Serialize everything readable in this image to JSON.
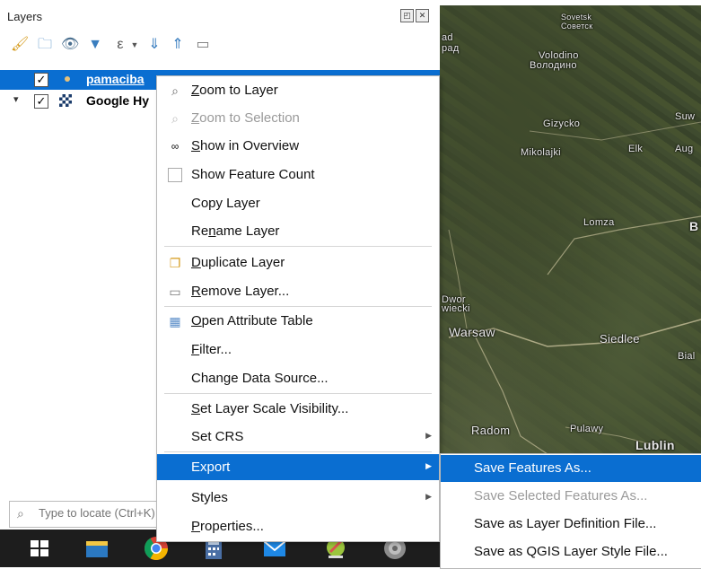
{
  "panel": {
    "title": "Layers",
    "float_btn": "◰",
    "close_btn": "✕",
    "toolbar": [
      {
        "name": "style-manager-icon",
        "glyph": "🖌",
        "color": "#d59a1a"
      },
      {
        "name": "add-group-icon",
        "glyph": "🗀",
        "color": "#3a7ebf"
      },
      {
        "name": "manage-visibility-icon",
        "glyph": "👁",
        "color": "#4a6f8f"
      },
      {
        "name": "filter-legend-icon",
        "glyph": "▼",
        "color": "#3a7ebf"
      },
      {
        "name": "filter-expression-icon",
        "glyph": "ε",
        "color": "#555555"
      },
      {
        "name": "expand-all-icon",
        "glyph": "⇓",
        "color": "#3a7ebf"
      },
      {
        "name": "collapse-all-icon",
        "glyph": "⇑",
        "color": "#3a7ebf"
      },
      {
        "name": "remove-layer-icon",
        "glyph": "▭",
        "color": "#777777"
      }
    ],
    "layers": [
      {
        "name": "pamaciba",
        "checked": "✓",
        "selected": true
      },
      {
        "name": "Google Hy",
        "checked": "✓",
        "expander": "▾"
      }
    ],
    "search_placeholder": "Type to locate (Ctrl+K)",
    "search_icon": "⌕"
  },
  "menu": {
    "items": [
      {
        "label": "Zoom to Layer",
        "icon": "zoom-icon",
        "glyph": "🔍"
      },
      {
        "label": "Zoom to Selection",
        "icon": "zoom-selection-icon",
        "glyph": "🔍",
        "disabled": true
      },
      {
        "label": "Show in Overview",
        "icon": "overview-icon",
        "glyph": "👓"
      },
      {
        "label": "Show Feature Count",
        "icon": "checkbox-icon",
        "glyph": ""
      },
      {
        "label": "Copy Layer"
      },
      {
        "label": "Rename Layer"
      },
      {
        "label": "Duplicate Layer",
        "icon": "duplicate-icon",
        "glyph": "❐"
      },
      {
        "label": "Remove Layer...",
        "icon": "remove-icon",
        "glyph": "▭"
      },
      {
        "label": "Open Attribute Table",
        "icon": "table-icon",
        "glyph": "▦"
      },
      {
        "label": "Filter..."
      },
      {
        "label": "Change Data Source..."
      },
      {
        "label": "Set Layer Scale Visibility..."
      },
      {
        "label": "Set CRS",
        "arrow": "▶"
      },
      {
        "label": "Export",
        "arrow": "▶",
        "highlighted": true
      },
      {
        "label": "Styles",
        "arrow": "▶"
      },
      {
        "label": "Properties..."
      }
    ]
  },
  "submenu": {
    "items": [
      {
        "label": "Save Features As...",
        "highlighted": true
      },
      {
        "label": "Save Selected Features As...",
        "disabled": true
      },
      {
        "label": "Save as Layer Definition File..."
      },
      {
        "label": "Save as QGIS Layer Style File..."
      }
    ]
  },
  "map_labels": [
    {
      "text": "Sovetsk"
    },
    {
      "text": "Советск"
    },
    {
      "text": "ad"
    },
    {
      "text": "рад"
    },
    {
      "text": "Volodino"
    },
    {
      "text": "Володино"
    },
    {
      "text": "Gizycko"
    },
    {
      "text": "Suw"
    },
    {
      "text": "Mikolajki"
    },
    {
      "text": "Elk"
    },
    {
      "text": "Aug"
    },
    {
      "text": "Lomza"
    },
    {
      "text": "B"
    },
    {
      "text": "Dwor"
    },
    {
      "text": "wiecki"
    },
    {
      "text": "Warsaw"
    },
    {
      "text": "Siedlce"
    },
    {
      "text": "Bial"
    },
    {
      "text": "Radom"
    },
    {
      "text": "Pulawy"
    },
    {
      "text": "Lublin"
    }
  ],
  "taskbar": [
    {
      "name": "windows-start-icon",
      "color": "#ffffff"
    },
    {
      "name": "file-explorer-icon",
      "color": "#f2c744"
    },
    {
      "name": "chrome-icon",
      "color": "#db4437"
    },
    {
      "name": "calculator-icon",
      "color": "#4a6fa5"
    },
    {
      "name": "mail-icon",
      "color": "#1e88e5"
    },
    {
      "name": "qgis-icon",
      "color": "#d9534f"
    },
    {
      "name": "speaker-icon",
      "color": "#aaaaaa"
    }
  ],
  "colors": {
    "accent": "#0a6ed1",
    "disabled": "#9a9a9a"
  }
}
